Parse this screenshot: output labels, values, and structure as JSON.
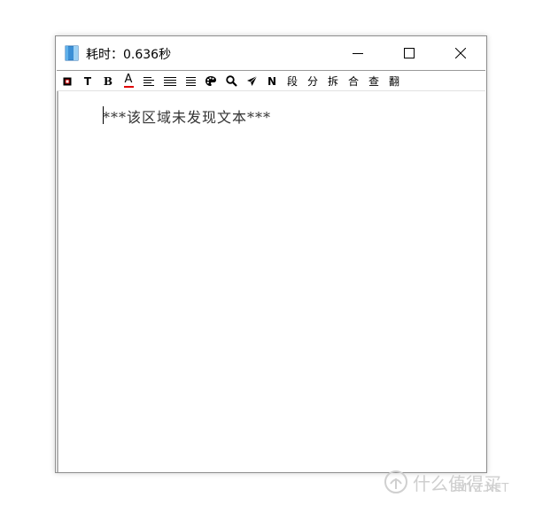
{
  "window": {
    "title": "耗时：0.636秒"
  },
  "toolbar": {
    "items": [
      {
        "name": "stop",
        "label": ""
      },
      {
        "name": "text",
        "label": "T"
      },
      {
        "name": "bold",
        "label": "B"
      },
      {
        "name": "font-color",
        "label": "A"
      },
      {
        "name": "align-left",
        "label": ""
      },
      {
        "name": "align-justify",
        "label": ""
      },
      {
        "name": "align-right",
        "label": ""
      },
      {
        "name": "palette",
        "label": ""
      },
      {
        "name": "search",
        "label": ""
      },
      {
        "name": "send",
        "label": ""
      },
      {
        "name": "n",
        "label": "N"
      },
      {
        "name": "paragraph",
        "label": "段"
      },
      {
        "name": "split",
        "label": "分"
      },
      {
        "name": "break",
        "label": "拆"
      },
      {
        "name": "merge",
        "label": "合"
      },
      {
        "name": "lookup",
        "label": "查"
      },
      {
        "name": "translate",
        "label": "翻"
      }
    ]
  },
  "content": {
    "notice": "***该区域未发现文本***"
  },
  "watermark": {
    "text": "什么值得买",
    "site": "SMYZ.NET"
  },
  "colors": {
    "font_color_underline": "#e00000",
    "stop_square": "#cc0000"
  }
}
